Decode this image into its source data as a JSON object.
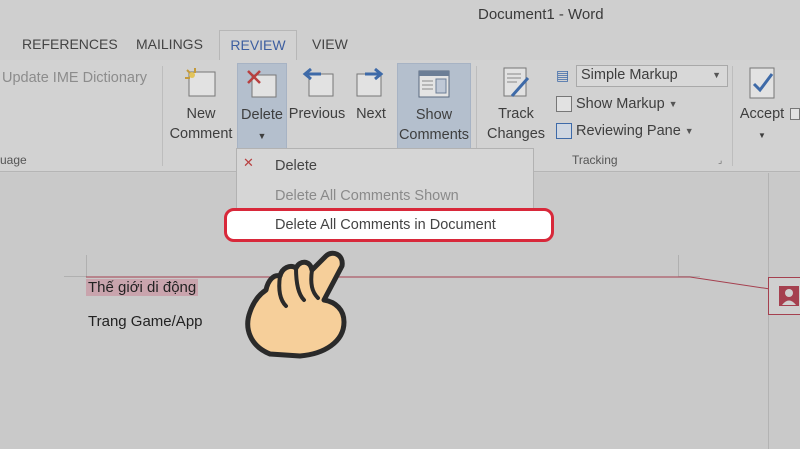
{
  "window": {
    "title": "Document1 - Word"
  },
  "tabs": [
    "REFERENCES",
    "MAILINGS",
    "REVIEW",
    "VIEW"
  ],
  "ribbon": {
    "ime_label": "Update IME Dictionary",
    "language_group_label": "uage",
    "comments": {
      "new_comment_l1": "New",
      "new_comment_l2": "Comment",
      "delete_label": "Delete",
      "previous_label": "Previous",
      "next_label": "Next",
      "show_comments_l1": "Show",
      "show_comments_l2": "Comments"
    },
    "tracking": {
      "track_changes_l1": "Track",
      "track_changes_l2": "Changes",
      "markup_mode": "Simple Markup",
      "show_markup": "Show Markup",
      "reviewing_pane": "Reviewing Pane",
      "group_label": "Tracking"
    },
    "accept_label": "Accept"
  },
  "delete_menu": {
    "delete": "Delete",
    "delete_all_shown": "Delete All Comments Shown",
    "delete_all_in_doc": "Delete All Comments in Document"
  },
  "document": {
    "line1": "Thế giới di động",
    "line2": "Trang Game/App"
  },
  "colors": {
    "accent_red": "#d8283a",
    "comment_color": "#a5404f",
    "active_tab_text": "#3e5fa0"
  },
  "icons": {
    "pointer": "hand-pointer-icon"
  }
}
